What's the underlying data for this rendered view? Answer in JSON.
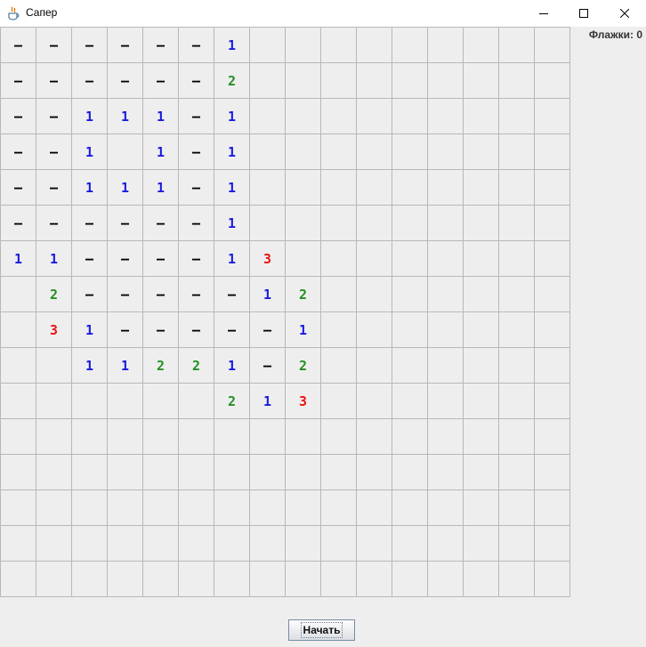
{
  "window": {
    "title": "Сапер",
    "icon": "java-cup-icon"
  },
  "status": {
    "flags_label": "Флажки: 0"
  },
  "controls": {
    "start_label": "Начать"
  },
  "colors": {
    "one": "#1a1adf",
    "two": "#239023",
    "three": "#ee1111",
    "dash": "#000000",
    "cell_bg": "#eeeeee",
    "grid_line": "#b8b8b8"
  },
  "board": {
    "columns": 16,
    "rows": 16,
    "cells": [
      [
        "–",
        "–",
        "–",
        "–",
        "–",
        "–",
        "1",
        "",
        "",
        "",
        "",
        "",
        "",
        "",
        "",
        ""
      ],
      [
        "–",
        "–",
        "–",
        "–",
        "–",
        "–",
        "2",
        "",
        "",
        "",
        "",
        "",
        "",
        "",
        "",
        ""
      ],
      [
        "–",
        "–",
        "1",
        "1",
        "1",
        "–",
        "1",
        "",
        "",
        "",
        "",
        "",
        "",
        "",
        "",
        ""
      ],
      [
        "–",
        "–",
        "1",
        "",
        "1",
        "–",
        "1",
        "",
        "",
        "",
        "",
        "",
        "",
        "",
        "",
        ""
      ],
      [
        "–",
        "–",
        "1",
        "1",
        "1",
        "–",
        "1",
        "",
        "",
        "",
        "",
        "",
        "",
        "",
        "",
        ""
      ],
      [
        "–",
        "–",
        "–",
        "–",
        "–",
        "–",
        "1",
        "",
        "",
        "",
        "",
        "",
        "",
        "",
        "",
        ""
      ],
      [
        "1",
        "1",
        "–",
        "–",
        "–",
        "–",
        "1",
        "3",
        "",
        "",
        "",
        "",
        "",
        "",
        "",
        ""
      ],
      [
        "",
        "2",
        "–",
        "–",
        "–",
        "–",
        "–",
        "1",
        "2",
        "",
        "",
        "",
        "",
        "",
        "",
        ""
      ],
      [
        "",
        "3",
        "1",
        "–",
        "–",
        "–",
        "–",
        "–",
        "1",
        "",
        "",
        "",
        "",
        "",
        "",
        ""
      ],
      [
        "",
        "",
        "1",
        "1",
        "2",
        "2",
        "1",
        "–",
        "2",
        "",
        "",
        "",
        "",
        "",
        "",
        ""
      ],
      [
        "",
        "",
        "",
        "",
        "",
        "",
        "2",
        "1",
        "3",
        "",
        "",
        "",
        "",
        "",
        "",
        ""
      ],
      [
        "",
        "",
        "",
        "",
        "",
        "",
        "",
        "",
        "",
        "",
        "",
        "",
        "",
        "",
        "",
        ""
      ],
      [
        "",
        "",
        "",
        "",
        "",
        "",
        "",
        "",
        "",
        "",
        "",
        "",
        "",
        "",
        "",
        ""
      ],
      [
        "",
        "",
        "",
        "",
        "",
        "",
        "",
        "",
        "",
        "",
        "",
        "",
        "",
        "",
        "",
        ""
      ],
      [
        "",
        "",
        "",
        "",
        "",
        "",
        "",
        "",
        "",
        "",
        "",
        "",
        "",
        "",
        "",
        ""
      ],
      [
        "",
        "",
        "",
        "",
        "",
        "",
        "",
        "",
        "",
        "",
        "",
        "",
        "",
        "",
        "",
        ""
      ]
    ]
  }
}
